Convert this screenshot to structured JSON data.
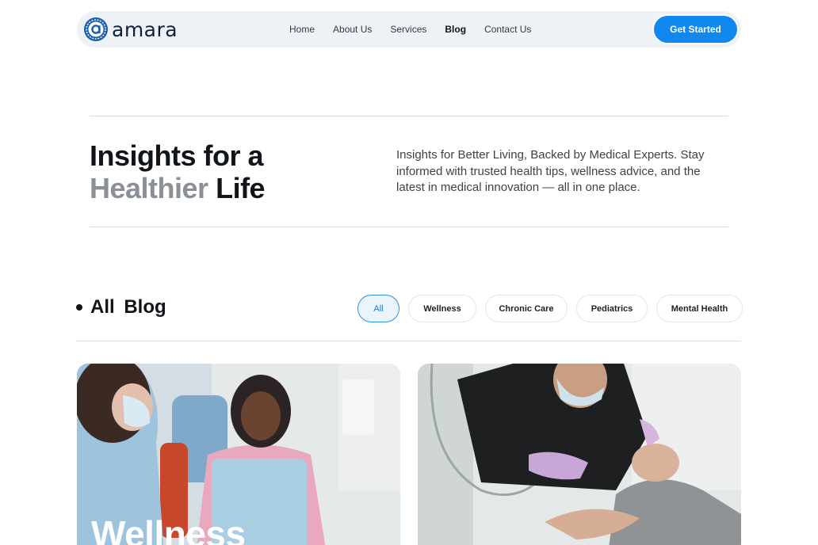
{
  "brand": {
    "name": "amara"
  },
  "nav": {
    "links": [
      {
        "label": "Home",
        "active": false
      },
      {
        "label": "About Us",
        "active": false
      },
      {
        "label": "Services",
        "active": false
      },
      {
        "label": "Blog",
        "active": true
      },
      {
        "label": "Contact Us",
        "active": false
      }
    ],
    "cta_label": "Get Started"
  },
  "hero": {
    "title_line1": "Insights for a",
    "title_muted": "Healthier",
    "title_end": "Life",
    "description": "Insights for Better Living, Backed by Medical Experts. Stay informed with trusted health tips, wellness advice, and the latest in medical innovation — all in one place."
  },
  "blog": {
    "title": "All Blog",
    "filters": [
      {
        "label": "All",
        "active": true
      },
      {
        "label": "Wellness",
        "active": false
      },
      {
        "label": "Chronic Care",
        "active": false
      },
      {
        "label": "Pediatrics",
        "active": false
      },
      {
        "label": "Mental Health",
        "active": false
      }
    ],
    "cards": [
      {
        "category": "Wellness"
      }
    ]
  },
  "colors": {
    "accent": "#1188f0",
    "nav_bg": "#eef2f7",
    "muted_text": "#8a9096"
  }
}
